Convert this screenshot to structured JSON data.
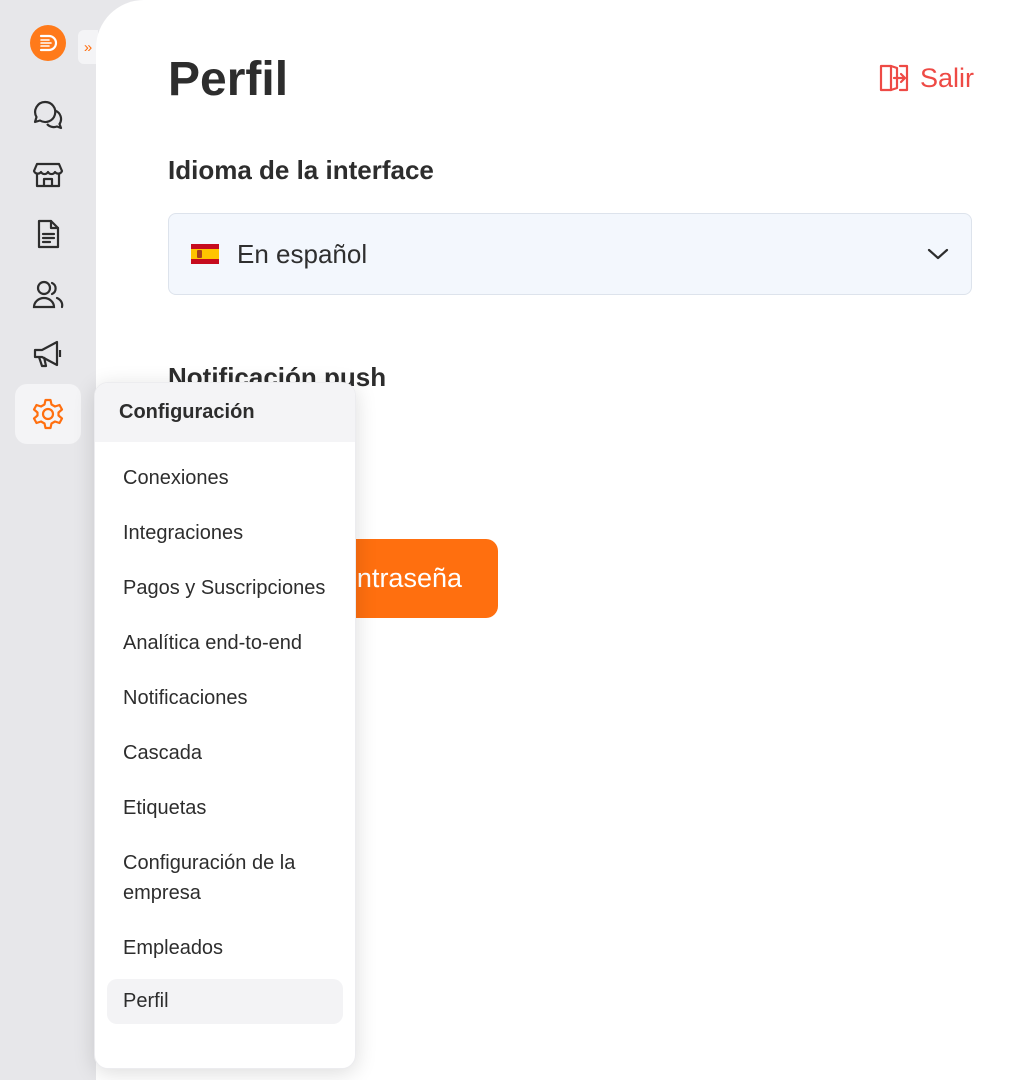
{
  "page": {
    "title": "Perfil",
    "logout_label": "Salir",
    "language_section_title": "Idioma de la interface",
    "language_value": "En español",
    "push_section_title": "Notificación push",
    "password_button_label": "Cambiar contraseña"
  },
  "popover": {
    "title": "Configuración",
    "items": [
      {
        "label": "Conexiones"
      },
      {
        "label": "Integraciones"
      },
      {
        "label": "Pagos y Suscripciones"
      },
      {
        "label": "Analítica end-to-end"
      },
      {
        "label": "Notificaciones"
      },
      {
        "label": "Cascada"
      },
      {
        "label": "Etiquetas"
      },
      {
        "label": "Configuración de la empresa"
      },
      {
        "label": "Empleados"
      },
      {
        "label": "Perfil"
      }
    ],
    "active_item": "Perfil"
  },
  "sidebar": {
    "icons": [
      "chat-icon",
      "store-icon",
      "document-icon",
      "users-icon",
      "megaphone-icon",
      "gear-icon"
    ],
    "active_icon": "gear-icon"
  },
  "colors": {
    "accent": "#FF6F0F",
    "danger": "#EE4A45",
    "sidebar_bg": "#E7E7EA",
    "select_bg": "#F3F7FD"
  }
}
